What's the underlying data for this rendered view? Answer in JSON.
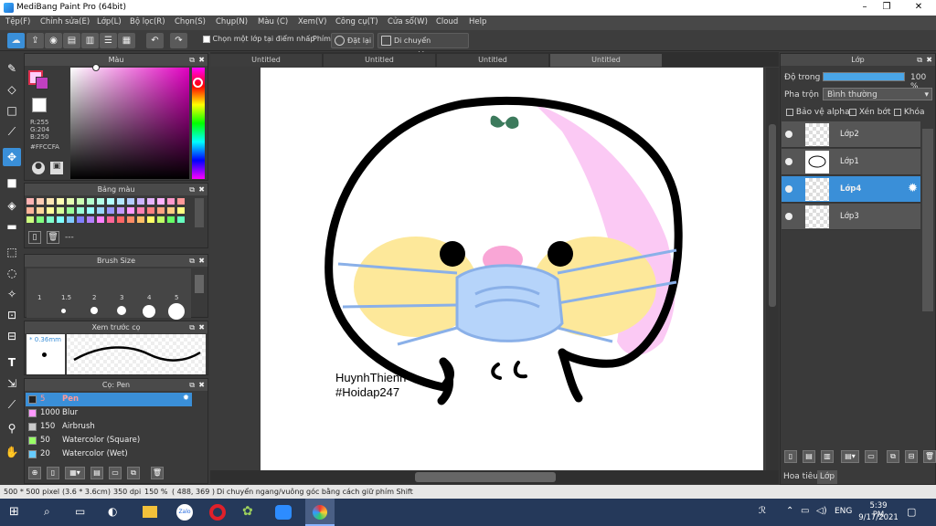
{
  "window": {
    "title": "MediBang Paint Pro (64bit)",
    "min": "–",
    "max": "❐",
    "close": "✕"
  },
  "menu": [
    "Tệp(F)",
    "Chỉnh sửa(E)",
    "Lớp(L)",
    "Bộ lọc(R)",
    "Chọn(S)",
    "Chụp(N)",
    "Màu (C)",
    "Xem(V)",
    "Công cụ(T)",
    "Cửa sổ(W)",
    "Cloud",
    "Help"
  ],
  "toolbar": {
    "checkbox_label": "Chọn một lớp tại điểm nhấp",
    "snap_label": "Phím",
    "snap_reset": "Đặt lại",
    "snap_mode": "Di chuyển ngang/dọc"
  },
  "color_panel": {
    "title": "Màu",
    "r": "R:255",
    "g": "G:204",
    "b": "B:250",
    "hex": "#FFCCFA",
    "primary_color": "#ffccfa"
  },
  "palette_panel": {
    "title": "Bảng màu",
    "label": "---"
  },
  "brush_size_panel": {
    "title": "Brush Size",
    "sizes": [
      "1",
      "1.5",
      "2",
      "3",
      "4",
      "5"
    ]
  },
  "preview_panel": {
    "title": "Xem trước cọ",
    "size": "0.36mm"
  },
  "brush_panel": {
    "title": "Cọ: Pen",
    "brushes": [
      {
        "size": "5",
        "name": "Pen",
        "color": "#ff9999"
      },
      {
        "size": "1000",
        "name": "Blur",
        "color": "#ff99ff"
      },
      {
        "size": "150",
        "name": "Airbrush",
        "color": "#cccccc"
      },
      {
        "size": "50",
        "name": "Watercolor (Square)",
        "color": "#99ff66"
      },
      {
        "size": "20",
        "name": "Watercolor (Wet)",
        "color": "#66ccff"
      }
    ]
  },
  "tabs": [
    "Untitled",
    "Untitled",
    "Untitled",
    "Untitled"
  ],
  "canvas_text": {
    "line1": "HuynhThienn",
    "line2": "#Hoidap247"
  },
  "layer_panel": {
    "title": "Lớp",
    "opacity_label": "Độ trong",
    "opacity_value": "100 %",
    "opacity": 1.0,
    "blend_label": "Pha trộn",
    "blend_value": "Bình thường",
    "protect_alpha": "Bảo vệ alpha",
    "clipping": "Xén bớt",
    "lock": "Khóa",
    "layers": [
      "Lớp2",
      "Lớp1",
      "Lớp4",
      "Lớp3"
    ],
    "selected": "Lớp4",
    "tab_navigator": "Hoa tiêu",
    "tab_layer": "Lớp"
  },
  "status": {
    "size": "500 * 500 pixel",
    "cm": "(3.6 * 3.6cm)",
    "dpi": "350 dpi",
    "zoom": "150 %",
    "coords": "( 488, 369 )",
    "hint": "Di chuyển ngang/vuông góc bằng cách giữ phím Shift"
  },
  "taskbar": {
    "time": "5:39 PM",
    "date": "9/17/2021",
    "lang": "ENG"
  }
}
